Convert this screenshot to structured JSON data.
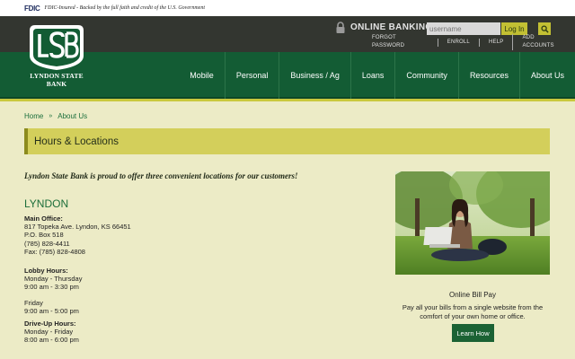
{
  "fdic": {
    "logo": "FDIC",
    "text": "FDIC-Insured - Backed by the full faith and credit of the U.S. Government"
  },
  "header": {
    "online_banking_label": "ONLINE BANKING",
    "username_placeholder": "username",
    "login_label": "Log In",
    "util_links": [
      "FORGOT PASSWORD",
      "ENROLL",
      "HELP",
      "ADD ACCOUNTS"
    ]
  },
  "logo": {
    "monogram": "LSB",
    "name": "LYNDON STATE BANK"
  },
  "nav": {
    "items": [
      "Mobile",
      "Personal",
      "Business / Ag",
      "Loans",
      "Community",
      "Resources",
      "About Us"
    ]
  },
  "breadcrumb": {
    "items": [
      "Home",
      "About Us"
    ],
    "separator": "»"
  },
  "page": {
    "title": "Hours & Locations",
    "intro": "Lyndon State Bank is proud to offer three convenient locations for our customers!"
  },
  "location": {
    "name": "LYNDON",
    "main_office_label": "Main Office:",
    "address_lines": [
      "817 Topeka Ave. Lyndon, KS 66451",
      "P.O. Box 518",
      "(785) 828-4411",
      "Fax: (785) 828-4808"
    ],
    "lobby_label": "Lobby Hours:",
    "lobby_lines": [
      "Monday - Thursday",
      "9:00 am - 3:30 pm"
    ],
    "friday_lines": [
      "Friday",
      "9:00 am - 5:00 pm"
    ],
    "drive_label": "Drive-Up Hours:",
    "drive_lines": [
      "Monday - Friday",
      "8:00 am - 6:00 pm"
    ]
  },
  "billpay": {
    "title": "Online Bill Pay",
    "description": "Pay all your bills from a single website from the comfort of your own home or office.",
    "button_label": "Learn How"
  },
  "colors": {
    "nav_green": "#135c34",
    "accent_yellow": "#c2c033",
    "page_bg": "#ecebc6"
  }
}
